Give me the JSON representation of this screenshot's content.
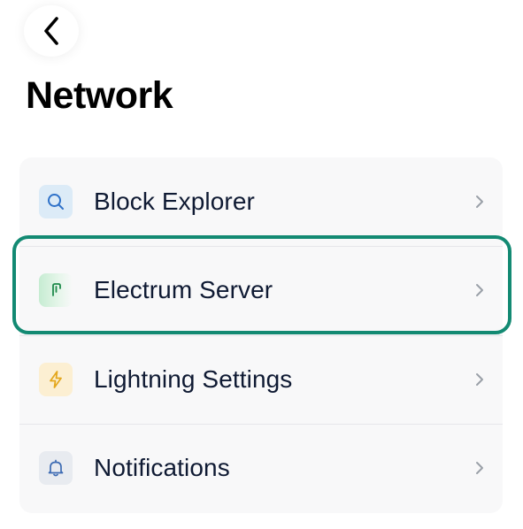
{
  "header": {
    "back_icon": "chevron-left-icon",
    "title": "Network"
  },
  "menu": {
    "items": [
      {
        "label": "Block Explorer",
        "icon": "search-icon",
        "icon_color": "#2f72c9",
        "icon_bg": "#dcebf7"
      },
      {
        "label": "Electrum Server",
        "icon": "server-icon",
        "icon_color": "#1e8a4a",
        "icon_bg": "#c6ecd2"
      },
      {
        "label": "Lightning Settings",
        "icon": "lightning-icon",
        "icon_color": "#e4a81f",
        "icon_bg": "#fcefd2"
      },
      {
        "label": "Notifications",
        "icon": "bell-icon",
        "icon_color": "#3d6bb3",
        "icon_bg": "#e8ebf0"
      }
    ],
    "trailing_icon": "chevron-right-icon"
  },
  "highlight": {
    "target": "Electrum Server",
    "color": "#138a73"
  }
}
